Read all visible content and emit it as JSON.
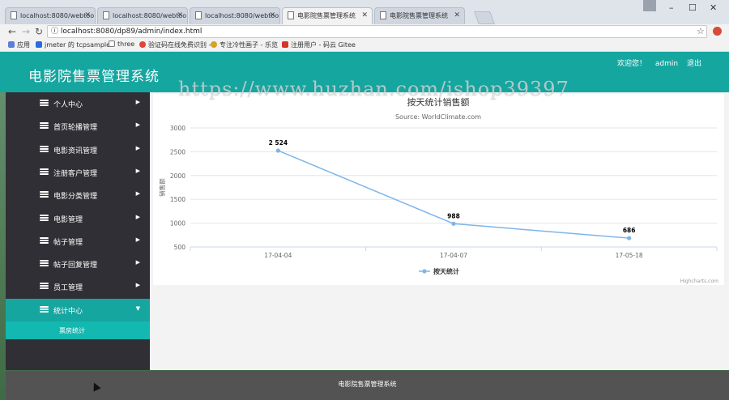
{
  "browser": {
    "tabs": [
      {
        "title": "localhost:8080/webtoo",
        "active": false
      },
      {
        "title": "localhost:8080/webtoo",
        "active": false
      },
      {
        "title": "localhost:8080/webtoo",
        "active": false
      },
      {
        "title": "电影院售票管理系统",
        "active": true
      },
      {
        "title": "电影院售票管理系统",
        "active": false
      }
    ],
    "url": "localhost:8080/dp89/admin/index.html",
    "bookmarks": [
      {
        "label": "应用",
        "color": "#5b7fd6"
      },
      {
        "label": "jmeter 的 tcpsample",
        "color": "#2a6be0"
      },
      {
        "label": "three",
        "color": "#ffffff"
      },
      {
        "label": "验证码在线免费识别 -",
        "color": "#e0453a"
      },
      {
        "label": "专注冷性画子 - 乐览",
        "color": "#d9a21b"
      },
      {
        "label": "注册用户 - 码云 Gitee",
        "color": "#d6342b"
      }
    ]
  },
  "header": {
    "title": "电影院售票管理系统",
    "welcome": "欢迎您！",
    "user": "admin",
    "logout": "退出"
  },
  "watermark": "https://www.huzhan.com/ishop39397",
  "sidebar": {
    "items": [
      {
        "label": "个人中心",
        "active": false
      },
      {
        "label": "首页轮播管理",
        "active": false
      },
      {
        "label": "电影资讯管理",
        "active": false
      },
      {
        "label": "注册客户管理",
        "active": false
      },
      {
        "label": "电影分类管理",
        "active": false
      },
      {
        "label": "电影管理",
        "active": false
      },
      {
        "label": "帖子管理",
        "active": false
      },
      {
        "label": "帖子回复管理",
        "active": false
      },
      {
        "label": "员工管理",
        "active": false
      },
      {
        "label": "统计中心",
        "active": true
      }
    ],
    "subitem": "票房统计"
  },
  "chart_data": {
    "type": "line",
    "title": "按天统计销售额",
    "subtitle": "Source: WorldClimate.com",
    "ylabel": "销售额",
    "xlabel": "",
    "categories": [
      "17-04-04",
      "17-04-07",
      "17-05-18"
    ],
    "series": [
      {
        "name": "按天统计",
        "values": [
          2524,
          988,
          686
        ],
        "labels": [
          "2 524",
          "988",
          "686"
        ],
        "color": "#7cb5ec"
      }
    ],
    "ylim": [
      500,
      3000
    ],
    "yticks": [
      500,
      1000,
      1500,
      2000,
      2500,
      3000
    ],
    "grid": true,
    "legend": "bottom-center",
    "credits": "Highcharts.com"
  },
  "footer": "电影院售票管理系统"
}
